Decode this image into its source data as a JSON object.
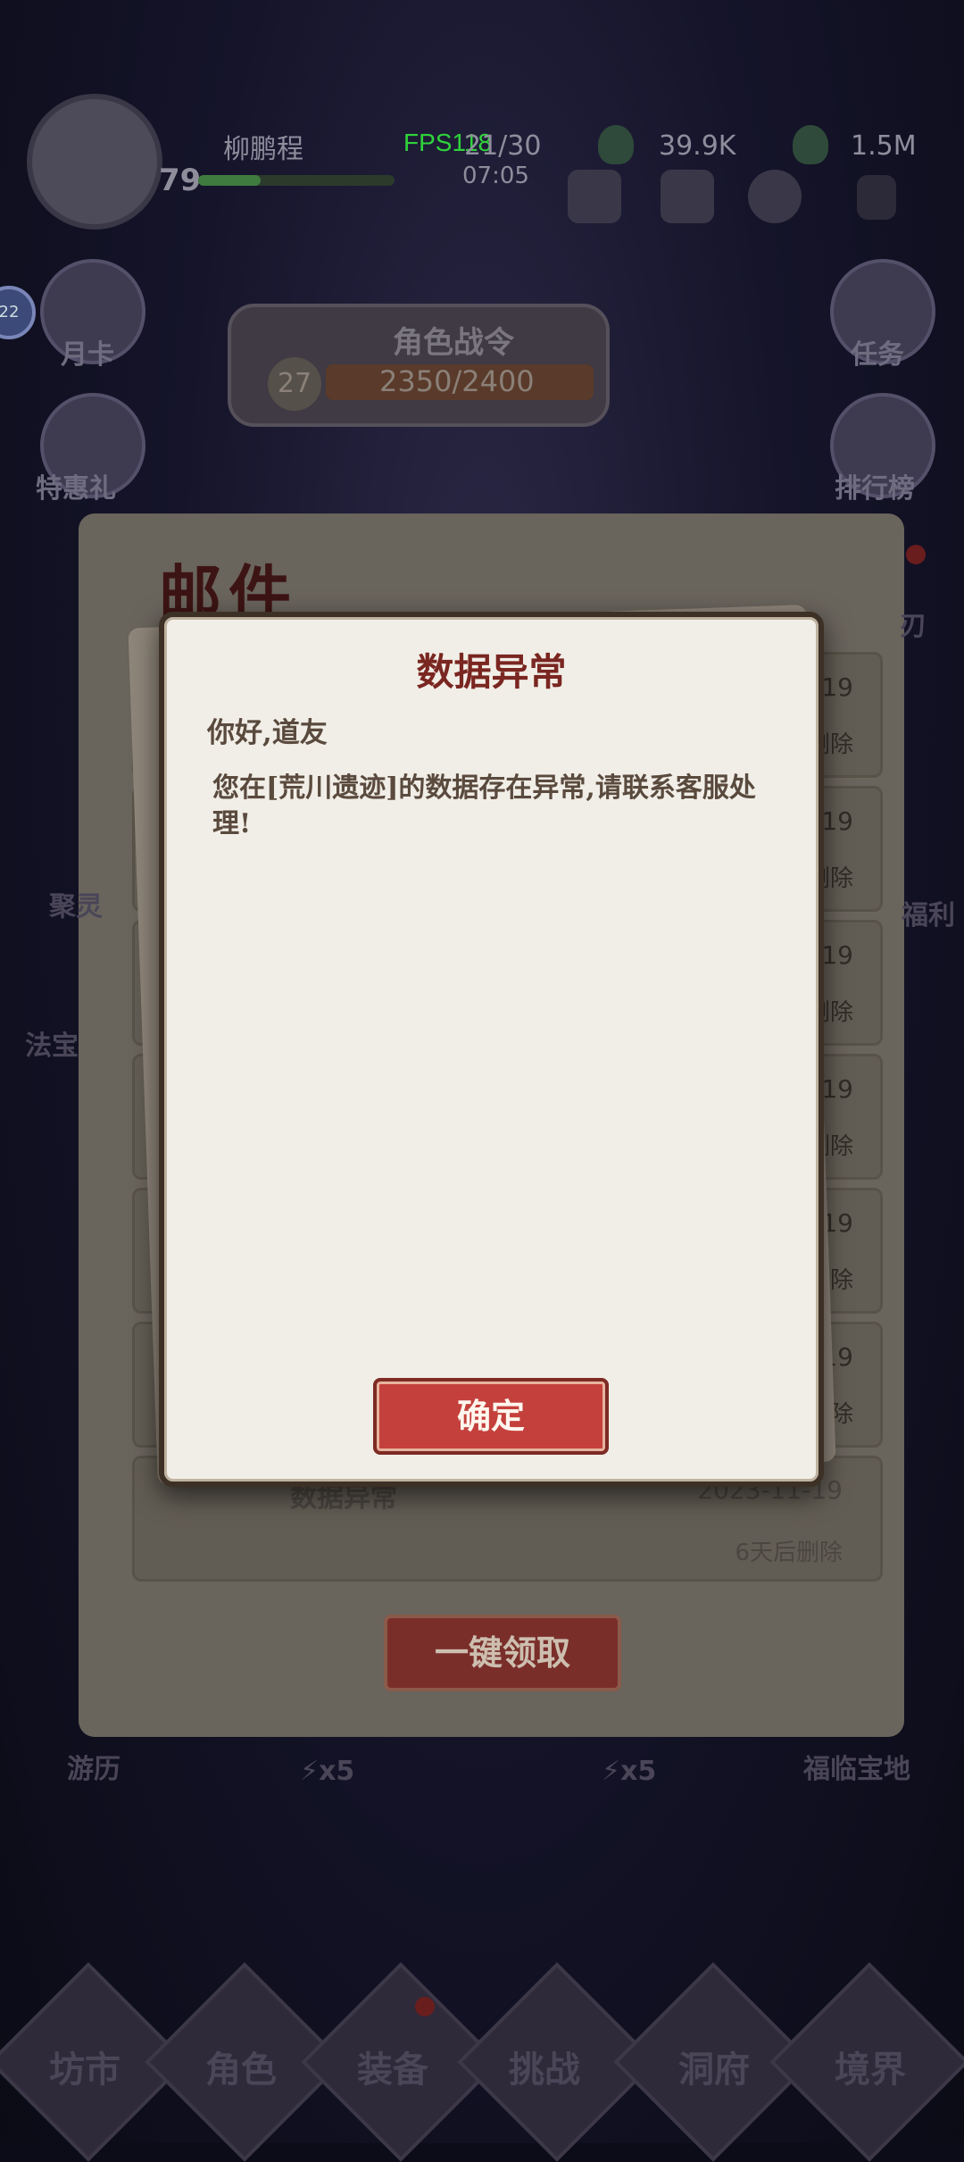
{
  "hud": {
    "player_name": "柳鹏程",
    "level": "79",
    "fps": "FPS118",
    "energy": "21/30",
    "timer": "07:05",
    "resource_1": "39.9K",
    "resource_2": "1.5M",
    "notification_count": "22"
  },
  "side_buttons": {
    "monthly_card": "月卡",
    "special_offer": "特惠礼",
    "quests": "任务",
    "leaderboard": "排行榜",
    "gather": "聚灵",
    "magic_treasure": "法宝",
    "history": "游历",
    "fortune": "福临宝地",
    "blade": "刃",
    "benefit": "福利"
  },
  "war_pass": {
    "title": "角色战令",
    "level": "27",
    "progress": "2350/2400"
  },
  "mail": {
    "title": "邮件",
    "rows": [
      {
        "date": "-19",
        "delete": "删除"
      },
      {
        "date": "-19",
        "delete": "删除"
      },
      {
        "date": "-19",
        "delete": "删除"
      },
      {
        "date": "-19",
        "delete": "删除"
      },
      {
        "date": "-19",
        "delete": "删除"
      },
      {
        "date": "-19",
        "delete": "删除"
      }
    ],
    "last_row": {
      "title": "数据异常",
      "date": "2023-11-19",
      "delete": "6天后删除"
    },
    "claim_all": "一键领取",
    "stamina_1": "⚡x5",
    "stamina_2": "⚡x5"
  },
  "bottom_nav": [
    "坊市",
    "角色",
    "装备",
    "挑战",
    "洞府",
    "境界"
  ],
  "dialog": {
    "title": "数据异常",
    "greeting": "你好,道友",
    "message": "您在[荒川遗迹]的数据存在异常,请联系客服处理!",
    "confirm": "确定"
  }
}
